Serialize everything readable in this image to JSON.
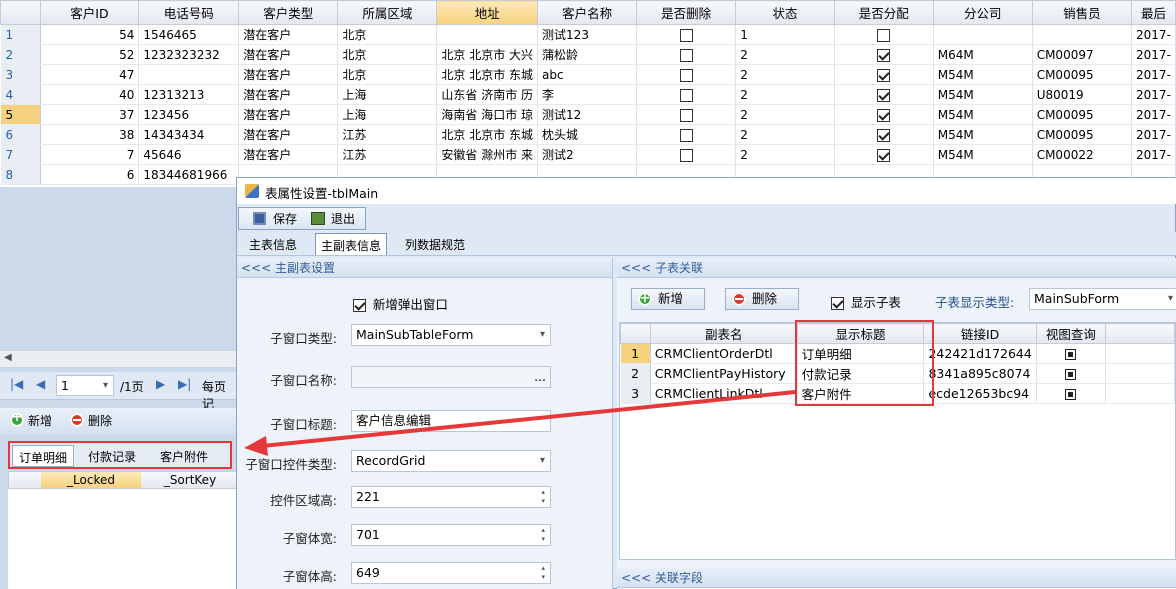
{
  "main_grid": {
    "columns": [
      "客户ID",
      "电话号码",
      "客户类型",
      "所属区域",
      "地址",
      "客户名称",
      "是否删除",
      "状态",
      "是否分配",
      "分公司",
      "销售员",
      "最后"
    ],
    "rows": [
      {
        "n": "1",
        "id": "54",
        "phone": "1546465",
        "type": "潜在客户",
        "region": "北京",
        "addr": "",
        "name": "测试123",
        "del": false,
        "status": "1",
        "assigned": false,
        "branch": "",
        "sales": "",
        "last": "2017-"
      },
      {
        "n": "2",
        "id": "52",
        "phone": "1232323232",
        "type": "潜在客户",
        "region": "北京",
        "addr": "北京 北京市 大兴",
        "name": "蒲松龄",
        "del": false,
        "status": "2",
        "assigned": true,
        "branch": "M64M",
        "sales": "CM00097",
        "last": "2017-"
      },
      {
        "n": "3",
        "id": "47",
        "phone": "",
        "type": "潜在客户",
        "region": "北京",
        "addr": "北京 北京市 东城",
        "name": "abc",
        "del": false,
        "status": "2",
        "assigned": true,
        "branch": "M54M",
        "sales": "CM00095",
        "last": "2017-"
      },
      {
        "n": "4",
        "id": "40",
        "phone": "12313213",
        "type": "潜在客户",
        "region": "上海",
        "addr": "山东省 济南市 历",
        "name": "李",
        "del": false,
        "status": "2",
        "assigned": true,
        "branch": "M54M",
        "sales": "U80019",
        "last": "2017-"
      },
      {
        "n": "5",
        "id": "37",
        "phone": "123456",
        "type": "潜在客户",
        "region": "上海",
        "addr": "海南省 海口市 琼",
        "name": "测试12",
        "del": false,
        "status": "2",
        "assigned": true,
        "branch": "M54M",
        "sales": "CM00095",
        "last": "2017-"
      },
      {
        "n": "6",
        "id": "38",
        "phone": "14343434",
        "type": "潜在客户",
        "region": "江苏",
        "addr": "北京 北京市 东城",
        "name": "枕头城",
        "del": false,
        "status": "2",
        "assigned": true,
        "branch": "M54M",
        "sales": "CM00095",
        "last": "2017-"
      },
      {
        "n": "7",
        "id": "7",
        "phone": "45646",
        "type": "潜在客户",
        "region": "江苏",
        "addr": "安徽省 滁州市 来",
        "name": "测试2",
        "del": false,
        "status": "2",
        "assigned": true,
        "branch": "M54M",
        "sales": "CM00022",
        "last": "2017-"
      },
      {
        "n": "8",
        "id": "6",
        "phone": "18344681966",
        "type": "",
        "region": "",
        "addr": "",
        "name": "",
        "del": false,
        "status": "",
        "assigned": false,
        "branch": "",
        "sales": "",
        "last": ""
      }
    ]
  },
  "pager": {
    "page": "1",
    "total": "/1页",
    "per_page": "每页记"
  },
  "left_toolbar": {
    "add": "新增",
    "delete": "删除"
  },
  "detail_tabs": [
    "订单明细",
    "付款记录",
    "客户附件"
  ],
  "detail_grid_cols": [
    "_Locked",
    "_SortKey"
  ],
  "dialog": {
    "title": "表属性设置-tblMain",
    "save": "保存",
    "exit": "退出",
    "tabs": [
      "主表信息",
      "主副表信息",
      "列数据规范"
    ],
    "left_section": "<<< 主副表设置",
    "popup_label": "新增弹出窗口",
    "popup_checked": true,
    "fields": [
      {
        "label": "子窗口类型:",
        "value": "MainSubTableForm"
      },
      {
        "label": "子窗口名称:",
        "value": "..."
      },
      {
        "label": "子窗口标题:",
        "value": "客户信息编辑"
      },
      {
        "label": "子窗口控件类型:",
        "value": "RecordGrid"
      },
      {
        "label": "控件区域高:",
        "value": "221"
      },
      {
        "label": "子窗体宽:",
        "value": "701"
      },
      {
        "label": "子窗体高:",
        "value": "649"
      }
    ],
    "right_section": "<<< 子表关联",
    "right_add": "新增",
    "right_delete": "删除",
    "show_sub_label": "显示子表",
    "show_sub_checked": true,
    "sub_display_label": "子表显示类型:",
    "sub_display_value": "MainSubForm",
    "sub_cols": [
      "副表名",
      "显示标题",
      "链接ID",
      "视图查询"
    ],
    "sub_rows": [
      {
        "n": "1",
        "table": "CRMClientOrderDtl",
        "title": "订单明细",
        "link": "242421d172644",
        "view": true
      },
      {
        "n": "2",
        "table": "CRMClientPayHistory",
        "title": "付款记录",
        "link": "8341a895c8074",
        "view": true
      },
      {
        "n": "3",
        "table": "CRMClientLinkDtl",
        "title": "客户附件",
        "link": "ecde12653bc94",
        "view": true
      }
    ],
    "bottom_section": "<<< 关联字段"
  },
  "colors": {
    "highlight_red": "#e5383a",
    "header_gold": "#f7d27e",
    "accent_blue": "#2e5d9a"
  }
}
